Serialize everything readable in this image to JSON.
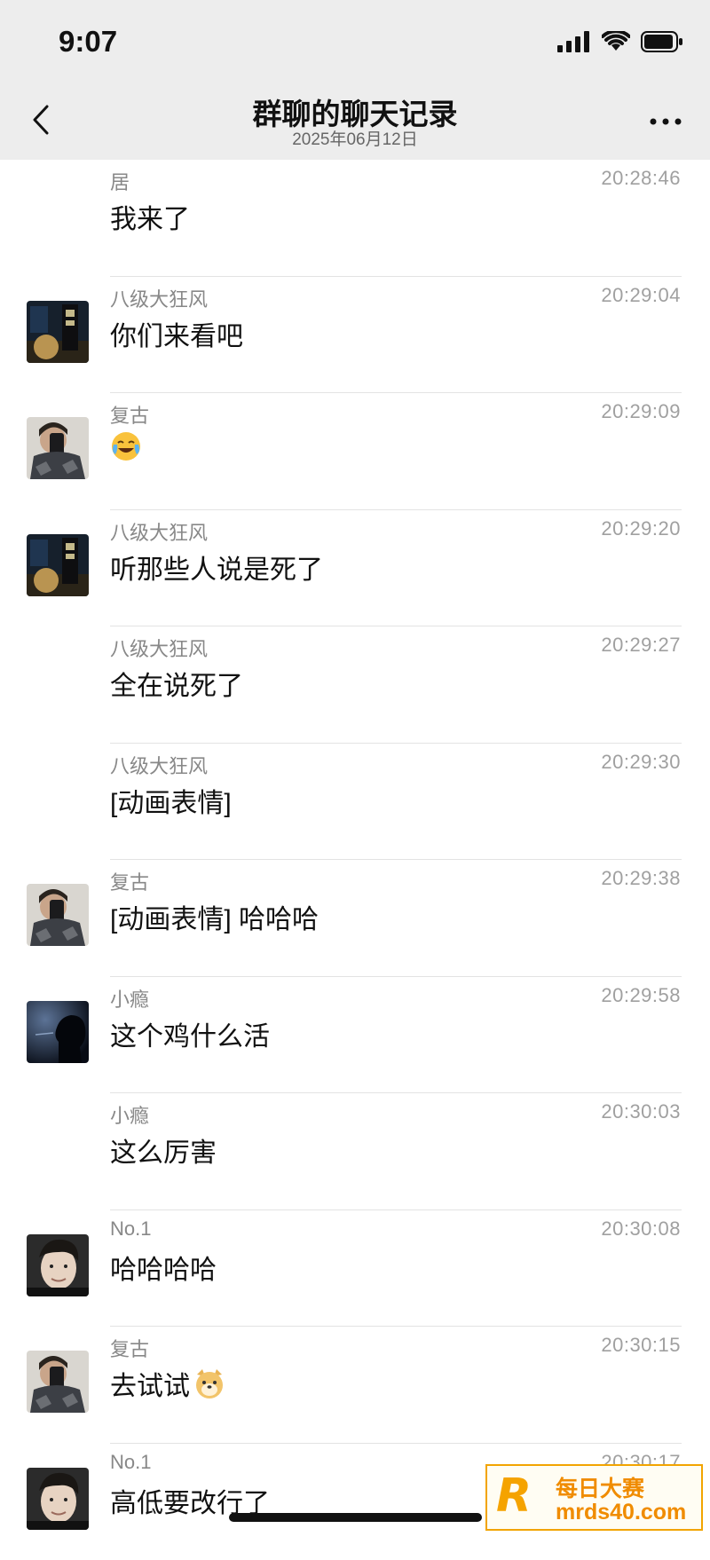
{
  "status_bar": {
    "time": "9:07"
  },
  "header": {
    "title": "群聊的聊天记录",
    "subtitle": "2025年06月12日"
  },
  "messages": [
    {
      "sender": "居",
      "time": "20:28:46",
      "text": "我来了",
      "avatar": "none"
    },
    {
      "sender": "八级大狂风",
      "time": "20:29:04",
      "text": "你们来看吧",
      "avatar": "dark-poster"
    },
    {
      "sender": "复古",
      "time": "20:29:09",
      "text": "",
      "emoji": "laughing-crying-emoji",
      "avatar": "mirror-selfie"
    },
    {
      "sender": "八级大狂风",
      "time": "20:29:20",
      "text": "听那些人说是死了",
      "avatar": "dark-poster"
    },
    {
      "sender": "八级大狂风",
      "time": "20:29:27",
      "text": "全在说死了",
      "avatar": "none"
    },
    {
      "sender": "八级大狂风",
      "time": "20:29:30",
      "text": "[动画表情]",
      "avatar": "none"
    },
    {
      "sender": "复古",
      "time": "20:29:38",
      "text": "[动画表情] 哈哈哈",
      "avatar": "mirror-selfie"
    },
    {
      "sender": "小瘾",
      "time": "20:29:58",
      "text": "这个鸡什么活",
      "avatar": "silhouette"
    },
    {
      "sender": "小瘾",
      "time": "20:30:03",
      "text": "这么厉害",
      "avatar": "none"
    },
    {
      "sender": "No.1",
      "time": "20:30:08",
      "text": "哈哈哈哈",
      "avatar": "face-portrait"
    },
    {
      "sender": "复古",
      "time": "20:30:15",
      "text": "去试试",
      "emoji": "doge-emoji",
      "avatar": "mirror-selfie"
    },
    {
      "sender": "No.1",
      "time": "20:30:17",
      "text": "高低要改行了",
      "avatar": "face-portrait"
    }
  ],
  "watermark": {
    "logo": "R",
    "name": "每日大赛",
    "site": "mrds40.com"
  }
}
